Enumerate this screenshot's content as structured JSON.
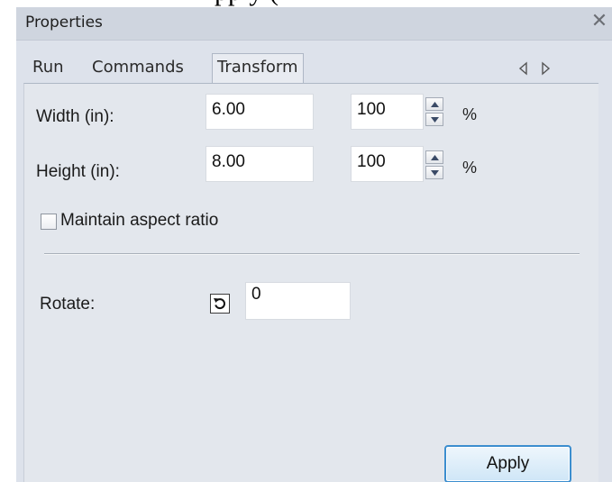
{
  "window": {
    "title": "Properties",
    "close_glyph": "✕",
    "header_text_fragment": "pply (",
    "close_icon": "close-icon"
  },
  "tabs": [
    {
      "label": "Run",
      "active": false
    },
    {
      "label": "Commands",
      "active": false
    },
    {
      "label": "Transform",
      "active": true
    }
  ],
  "tab_scroll": {
    "left_icon": "triangle-left-icon",
    "right_icon": "triangle-right-icon"
  },
  "transform": {
    "width": {
      "label": "Width (in):",
      "value": "6.00",
      "percent": "100",
      "unit": "%"
    },
    "height": {
      "label": "Height (in):",
      "value": "8.00",
      "percent": "100",
      "unit": "%"
    },
    "maintain_aspect": {
      "label": "Maintain aspect ratio",
      "checked": false
    },
    "rotate": {
      "label": "Rotate:",
      "value": "0",
      "icon": "rotate-ccw-icon"
    },
    "apply_label": "Apply"
  },
  "colors": {
    "panel_bg": "#dde2eb",
    "content_bg": "#e3e7ed",
    "apply_border": "#3c8ecf"
  }
}
